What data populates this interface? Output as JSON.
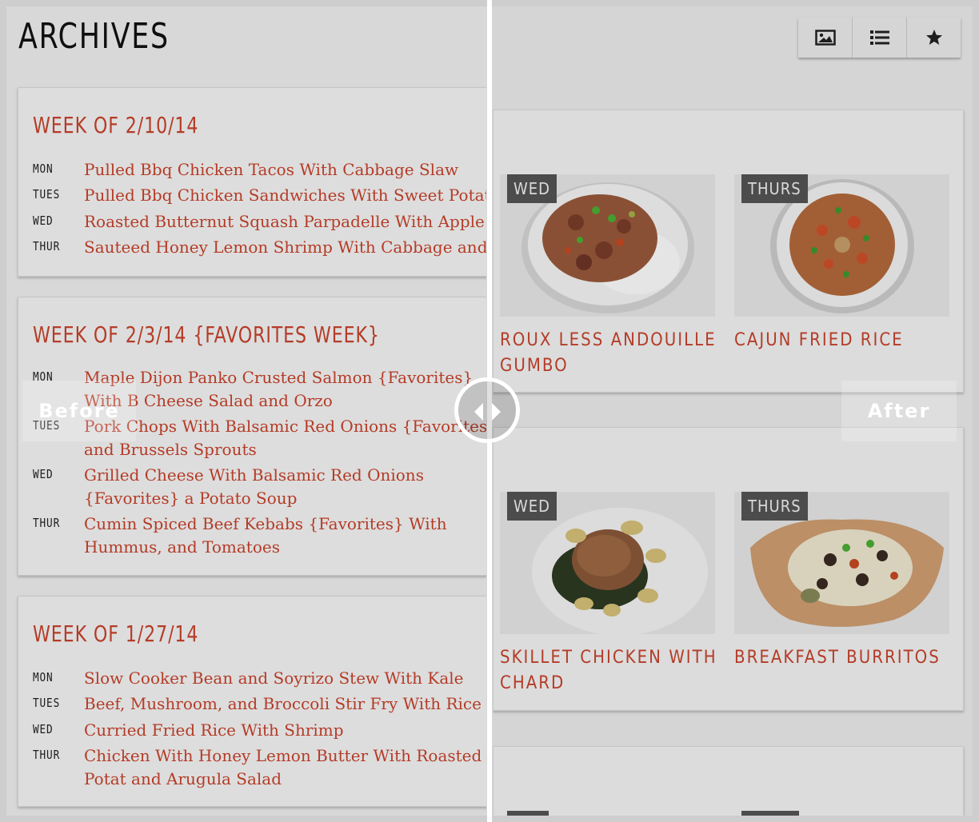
{
  "page": {
    "title": "ARCHIVES"
  },
  "weeks": [
    {
      "title": "WEEK OF 2/10/14",
      "meals": [
        {
          "day": "MON",
          "dish": "Pulled Bbq Chicken Tacos With Cabbage Slaw"
        },
        {
          "day": "TUES",
          "dish": "Pulled Bbq Chicken Sandwiches With Sweet Potato Fri"
        },
        {
          "day": "WED",
          "dish": "Roasted Butternut Squash Parpadelle With Apple Spin"
        },
        {
          "day": "THUR",
          "dish": "Sauteed Honey Lemon Shrimp With Cabbage and Carr"
        }
      ]
    },
    {
      "title": "WEEK OF 2/3/14 {FAVORITES WEEK}",
      "meals": [
        {
          "day": "MON",
          "dish": "Maple Dijon Panko Crusted Salmon {Favorites} With B Cheese Salad and Orzo"
        },
        {
          "day": "TUES",
          "dish": "Pork Chops With Balsamic Red Onions {Favorites} and Brussels Sprouts"
        },
        {
          "day": "WED",
          "dish": "Grilled Cheese With Balsamic Red Onions {Favorites} a Potato Soup"
        },
        {
          "day": "THUR",
          "dish": "Cumin Spiced Beef Kebabs {Favorites} With Hummus, and Tomatoes"
        }
      ]
    },
    {
      "title": "WEEK OF 1/27/14",
      "meals": [
        {
          "day": "MON",
          "dish": "Slow Cooker Bean and Soyrizo Stew With Kale"
        },
        {
          "day": "TUES",
          "dish": "Beef, Mushroom, and Broccoli Stir Fry With Rice"
        },
        {
          "day": "WED",
          "dish": "Curried Fried Rice With Shrimp"
        },
        {
          "day": "THUR",
          "dish": "Chicken With Honey Lemon Butter With Roasted Potat and Arugula Salad"
        }
      ]
    }
  ],
  "view_toggle": {
    "buttons": [
      {
        "icon": "image-icon"
      },
      {
        "icon": "list-icon"
      },
      {
        "icon": "star-icon"
      }
    ]
  },
  "grid_weeks": [
    {
      "tiles": [
        {
          "day": "WED",
          "title": "ROUX LESS ANDOUILLE GUMBO",
          "photo": "gumbo-bowl"
        },
        {
          "day": "THURS",
          "title": "CAJUN FRIED RICE",
          "photo": "fried-rice-bowl"
        }
      ]
    },
    {
      "tiles": [
        {
          "day": "WED",
          "title": "SKILLET CHICKEN WITH CHARD",
          "photo": "skillet-chicken-plate"
        },
        {
          "day": "THURS",
          "title": "BREAKFAST BURRITOS",
          "photo": "burrito-tortilla"
        }
      ]
    }
  ],
  "comparison": {
    "before_label": "Before",
    "after_label": "After"
  },
  "colors": {
    "accent": "#c9432c",
    "tag_bg": "#555555",
    "divider": "#ffffff"
  }
}
